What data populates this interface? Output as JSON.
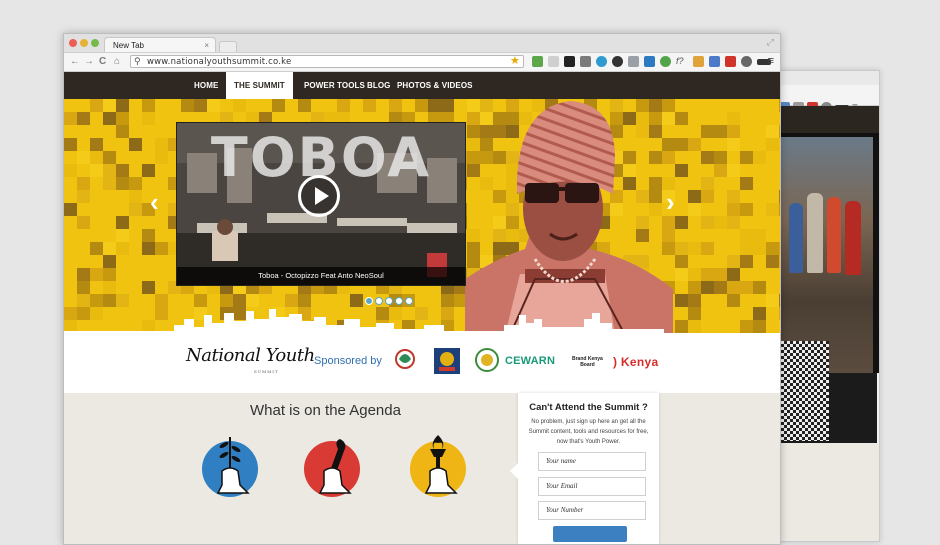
{
  "browser": {
    "tab_title": "New Tab",
    "tab_close": "×",
    "url": "www.nationalyouthsummit.co.ke",
    "nav_back": "←",
    "nav_forward": "→",
    "nav_reload": "C",
    "nav_home": "⌂",
    "resize_glyph": "⤢",
    "menu_glyph": "≡",
    "star_glyph": "★",
    "search_glyph": "⚲",
    "extension_icons": [
      "leaf-icon",
      "page-icon",
      "check-icon",
      "mail-icon",
      "swirl-icon",
      "lens-icon",
      "sun-icon",
      "cube-icon",
      "drop-icon",
      "fx-icon",
      "dna-icon",
      "flag-icon",
      "pin-icon",
      "clock-icon",
      "glasses-icon"
    ],
    "traffic_colors": [
      "#ec5f57",
      "#e6b235",
      "#78b94c"
    ]
  },
  "site": {
    "nav": {
      "items": [
        "HOME",
        "THE SUMMIT",
        "POWER TOOLS",
        "BLOG",
        "PHOTOS & VIDEOS"
      ],
      "active_index": 1
    },
    "hero": {
      "video_title": "TOBOA",
      "caption": "Toboa - Octopizzo Feat Anto NeoSoul",
      "prev_arrow": "‹",
      "next_arrow": "›",
      "slide_count": 5,
      "active_slide": 0,
      "accent": "#f0c310"
    },
    "sponsors": {
      "logo_name": "National Youth",
      "logo_sub": "SUMMIT",
      "sponsored_by": "Sponsored by",
      "cewarn": "CEWARN",
      "brand_kenya": "Brand Kenya\nBoard",
      "kenya": ") Kenya"
    },
    "agenda": {
      "title": "What is on the Agenda",
      "icons": [
        "olive-branch-icon",
        "wrench-icon",
        "torch-icon"
      ],
      "colors": [
        "#2f7fc2",
        "#d93a33",
        "#efb515"
      ]
    },
    "signup": {
      "heading": "Can't Attend the Summit ?",
      "text": "No problem, just sign up here an get all the Summit content, tools and resources for free, now that's Youth Power.",
      "name_placeholder": "Your name",
      "email_placeholder": "Your Email",
      "number_placeholder": "Your Number"
    }
  }
}
